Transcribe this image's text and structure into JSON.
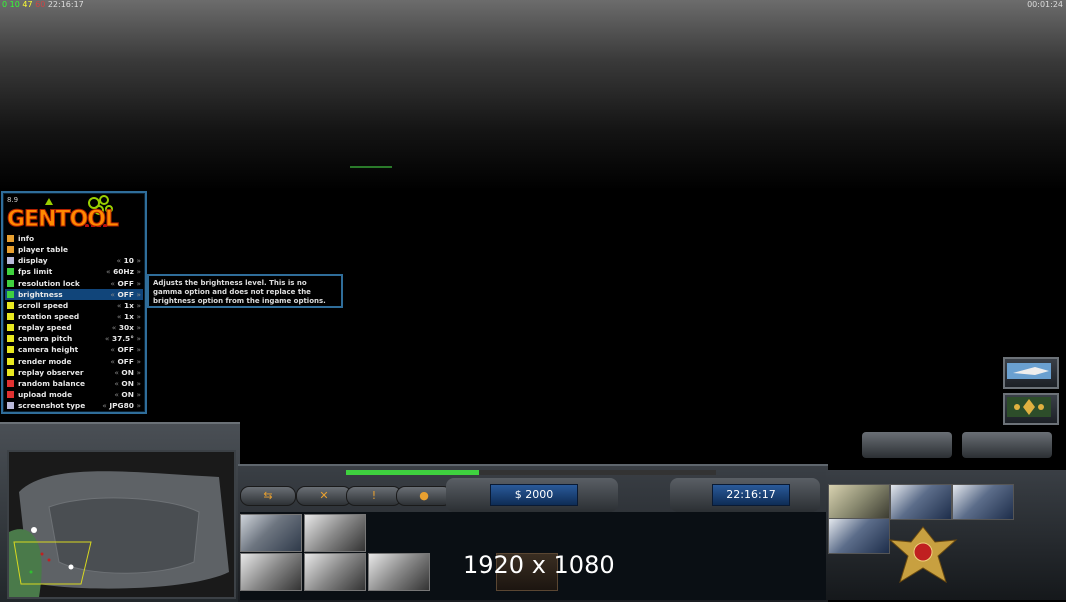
{
  "hud_top_left": {
    "a": "0",
    "b": "10",
    "c": "47",
    "d": "60",
    "time": "22:16:17"
  },
  "hud_top_right": {
    "time": "00:01:24"
  },
  "gentool": {
    "version": "8.9",
    "logo": "GENTOOL",
    "items": [
      {
        "label": "info",
        "value": "",
        "color": "#e8a030",
        "selected": false
      },
      {
        "label": "player table",
        "value": "",
        "color": "#e8a030",
        "selected": false
      },
      {
        "label": "display",
        "value": "10",
        "color": "#b9b9d9",
        "selected": false
      },
      {
        "label": "fps limit",
        "value": "60Hz",
        "color": "#3fd13f",
        "selected": false
      },
      {
        "label": "resolution lock",
        "value": "OFF",
        "color": "#3fd13f",
        "selected": false
      },
      {
        "label": "brightness",
        "value": "OFF",
        "color": "#3fd13f",
        "selected": true
      },
      {
        "label": "scroll speed",
        "value": "1x",
        "color": "#e8e820",
        "selected": false
      },
      {
        "label": "rotation speed",
        "value": "1x",
        "color": "#e8e820",
        "selected": false
      },
      {
        "label": "replay speed",
        "value": "30x",
        "color": "#e8e820",
        "selected": false
      },
      {
        "label": "camera pitch",
        "value": "37.5°",
        "color": "#e8e820",
        "selected": false
      },
      {
        "label": "camera height",
        "value": "OFF",
        "color": "#e8e820",
        "selected": false
      },
      {
        "label": "render mode",
        "value": "OFF",
        "color": "#e8e820",
        "selected": false
      },
      {
        "label": "replay observer",
        "value": "ON",
        "color": "#e8e820",
        "selected": false
      },
      {
        "label": "random balance",
        "value": "ON",
        "color": "#e03030",
        "selected": false
      },
      {
        "label": "upload mode",
        "value": "ON",
        "color": "#e03030",
        "selected": false
      },
      {
        "label": "screenshot type",
        "value": "JPG80",
        "color": "#b9b9d9",
        "selected": false
      }
    ],
    "arrow_left": "«",
    "arrow_right": "»",
    "tooltip": "Adjusts the brightness level. This is no gamma option and does not replace the brightness option from the ingame options."
  },
  "hud": {
    "money": "$ 2000",
    "clock": "22:16:17",
    "resolution_overlay": "1920 x 1080",
    "power_level": 0.36,
    "command_icons": [
      "rotate-icon",
      "tools-icon",
      "alert-icon",
      "chat-icon"
    ]
  }
}
